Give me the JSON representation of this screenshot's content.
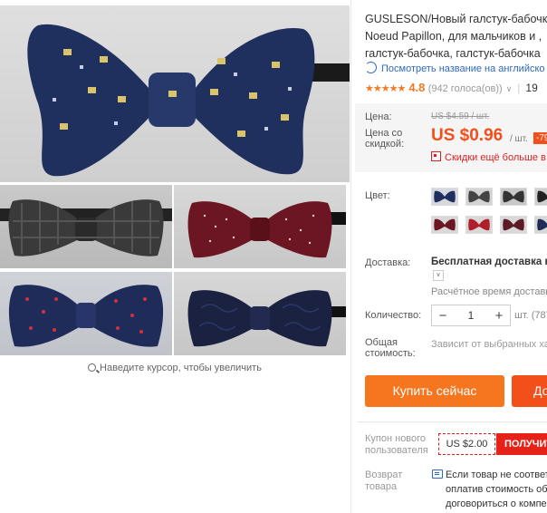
{
  "product": {
    "title_lines": [
      "GUSLESON/Новый галстук-бабочк",
      "Noeud Papillon, для мальчиков и ,",
      "галстук-бабочка, галстук-бабочка"
    ],
    "translate_link": "Посмотреть название на английско",
    "rating": {
      "stars": "★★★★★",
      "value": "4.8",
      "votes": "(942 голоса(ов))",
      "orders": "19"
    }
  },
  "gallery": {
    "zoom_hint": "Наведите курсор, чтобы увеличить"
  },
  "price": {
    "label": "Цена:",
    "old_price": "US $4.59 / шт.",
    "discount_label_line1": "Цена со",
    "discount_label_line2": "скидкой:",
    "price": "US $0.96",
    "per_unit": "/ шт.",
    "discount_badge": "-79",
    "promo_text": "Скидки ещё больше в п"
  },
  "options": {
    "color_label": "Цвет:",
    "shipping_label": "Доставка:",
    "shipping_value": "Бесплатная доставка в R",
    "shipping_estimate": "Расчётное время доставки",
    "quantity_label": "Количество:",
    "quantity_value": "1",
    "quantity_minus": "−",
    "quantity_plus": "+",
    "quantity_unit": "шт. (787",
    "total_label_line1": "Общая",
    "total_label_line2": "стоимость:",
    "total_value": "Зависит от выбранных хар"
  },
  "actions": {
    "buy_now": "Купить сейчас",
    "add_to_cart": "До"
  },
  "coupon": {
    "label_line1": "Купон нового",
    "label_line2": "пользователя",
    "amount": "US $2.00",
    "get_button": "ПОЛУЧИТЬ"
  },
  "returns": {
    "label_line1": "Возврат",
    "label_line2": "товара",
    "text_lines": [
      "Если товар не соответс",
      "оплатив стоимость обр",
      "договориться о компен"
    ]
  },
  "colors": {
    "accent_orange": "#f6761f",
    "price_red": "#f34f1a",
    "link_blue": "#2b68c4",
    "coupon_red": "#e62117"
  }
}
